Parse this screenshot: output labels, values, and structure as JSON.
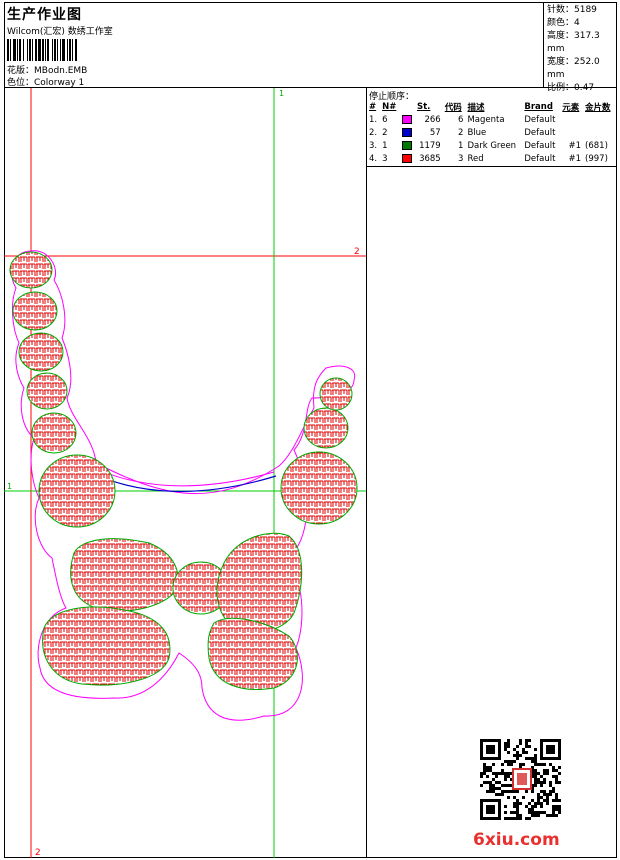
{
  "header": {
    "title": "生产作业图",
    "subtitle": "Wilcom(汇宏) 数绣工作室",
    "design_label": "花版：MBodn.EMB",
    "colorway_label": "色位：Colorway 1"
  },
  "summary": [
    "针数：5189",
    "颜色：4",
    "高度：317.3 mm",
    "宽度：252.0 mm",
    "比例：0.47"
  ],
  "stop_sequence": {
    "title": "停止顺序：",
    "headers": [
      "#",
      "N#",
      "St.",
      "代码",
      "描述",
      "Brand",
      "元素",
      "金片数"
    ],
    "rows": [
      {
        "num": "1.",
        "n": "6",
        "color": "#ff00ff",
        "st": "266",
        "code": "6",
        "desc": "Magenta",
        "brand": "Default",
        "elem": "",
        "seq": ""
      },
      {
        "num": "2.",
        "n": "2",
        "color": "#0000cc",
        "st": "57",
        "code": "2",
        "desc": "Blue",
        "brand": "Default",
        "elem": "",
        "seq": ""
      },
      {
        "num": "3.",
        "n": "1",
        "color": "#007a00",
        "st": "1179",
        "code": "1",
        "desc": "Dark Green",
        "brand": "Default",
        "elem": "#1",
        "seq": "(681)"
      },
      {
        "num": "4.",
        "n": "3",
        "color": "#ff0000",
        "st": "3685",
        "code": "3",
        "desc": "Red",
        "brand": "Default",
        "elem": "#1",
        "seq": "(997)"
      }
    ]
  },
  "guides": {
    "top_label": "1",
    "right_label": "2",
    "left_label": "1",
    "bottom_label": "2"
  },
  "watermark": "6xiu.com"
}
